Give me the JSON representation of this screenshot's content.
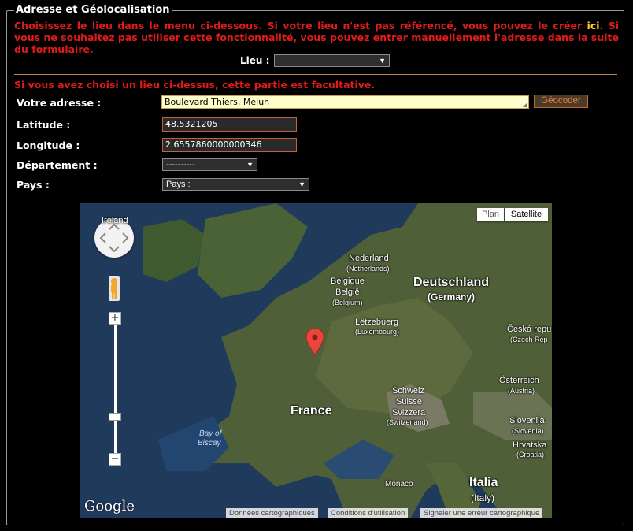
{
  "legend": "Adresse et Géolocalisation",
  "intro": {
    "before_link": "Choisissez le lieu dans le menu ci-dessous. Si votre lieu n'est pas référencé, vous pouvez le créer ",
    "link": "ici",
    "after_link": ". Si vous ne souhaitez pas utiliser cette fonctionnalité, vous pouvez entrer manuellement l'adresse dans la suite du formulaire."
  },
  "lieu": {
    "label": "Lieu :",
    "value": ""
  },
  "optional_note": "Si vous avez choisi un lieu ci-dessus, cette partie est facultative.",
  "form": {
    "address_label": "Votre adresse :",
    "address_value": "Boulevard Thiers, Melun",
    "geocode_button": "Géocoder",
    "latitude_label": "Latitude :",
    "latitude_value": "48.5321205",
    "longitude_label": "Longitude :",
    "longitude_value": "2.6557860000000346",
    "departement_label": "Département :",
    "departement_value": "----------",
    "pays_label": "Pays :",
    "pays_value": "Pays :"
  },
  "map": {
    "type_plan": "Plan",
    "type_satellite": "Satellite",
    "zoom_in": "+",
    "zoom_out": "−",
    "logo": "Google",
    "labels": {
      "ireland": "Ireland",
      "nederland": "Nederland",
      "nederland_sub": "(Netherlands)",
      "belgique": "Belgique",
      "belgie": "België",
      "belgium": "(Belgium)",
      "deutschland": "Deutschland",
      "germany": "(Germany)",
      "letzebuerg": "Lëtzebuerg",
      "luxembourg": "(Luxembourg)",
      "ceska": "Česká repu",
      "czech": "(Czech Rep",
      "france": "France",
      "bay1": "Bay of",
      "bay2": "Biscay",
      "schweiz": "Schweiz",
      "suisse": "Suisse",
      "svizzera": "Svizzera",
      "switzerland": "(Switzerland)",
      "osterreich": "Österreich",
      "austria": "(Austria)",
      "slovenija": "Slovenija",
      "slovenia": "(Slovenia)",
      "hrvatska": "Hrvatska",
      "croatia": "(Croatia)",
      "monaco": "Monaco",
      "italia": "Italia",
      "italy": "(Italy)"
    },
    "attribution": {
      "data": "Données cartographiques",
      "terms": "Conditions d'utilisation",
      "report": "Signaler une erreur cartographique"
    }
  }
}
